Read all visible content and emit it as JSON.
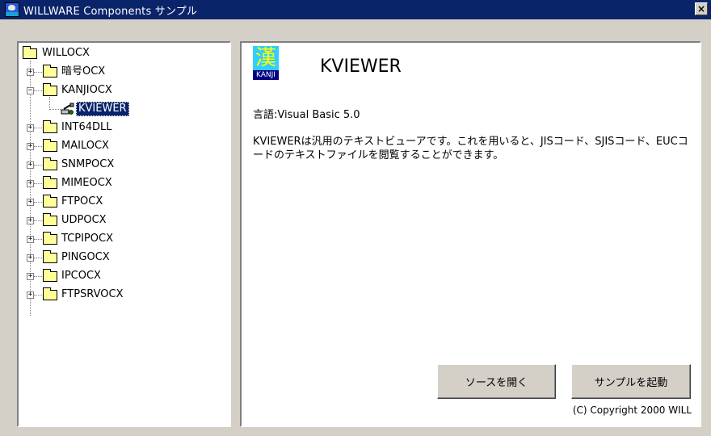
{
  "window": {
    "title": "WILLWARE Components サンプル",
    "close_glyph": "×"
  },
  "tree": {
    "root": "WILLOCX",
    "items": [
      {
        "label": "暗号OCX",
        "expander": "+"
      },
      {
        "label": "KANJIOCX",
        "expander": "−"
      },
      {
        "label": "KVIEWER",
        "selected": true
      },
      {
        "label": "INT64DLL",
        "expander": "+"
      },
      {
        "label": "MAILOCX",
        "expander": "+"
      },
      {
        "label": "SNMPOCX",
        "expander": "+"
      },
      {
        "label": "MIMEOCX",
        "expander": "+"
      },
      {
        "label": "FTPOCX",
        "expander": "+"
      },
      {
        "label": "UDPOCX",
        "expander": "+"
      },
      {
        "label": "TCPIPOCX",
        "expander": "+"
      },
      {
        "label": "PINGOCX",
        "expander": "+"
      },
      {
        "label": "IPCOCX",
        "expander": "+"
      },
      {
        "label": "FTPSRVOCX",
        "expander": "+"
      }
    ]
  },
  "detail": {
    "icon_kanji": "漢",
    "icon_caption": "KANJI",
    "component_name": "KVIEWER",
    "language": "言語:Visual Basic 5.0",
    "description": "KVIEWERは汎用のテキストビューアです。これを用いると、JISコード、SJISコード、EUCコードのテキストファイルを閲覧することができます。",
    "open_source_button": "ソースを開く",
    "run_sample_button": "サンプルを起動",
    "copyright": "(C) Copyright 2000 WILL"
  },
  "colors": {
    "titlebar": "#0a246a",
    "selection": "#0a246a",
    "face": "#d4d0c8",
    "folder": "#ffff99",
    "icon_bg": "#33ccff"
  }
}
